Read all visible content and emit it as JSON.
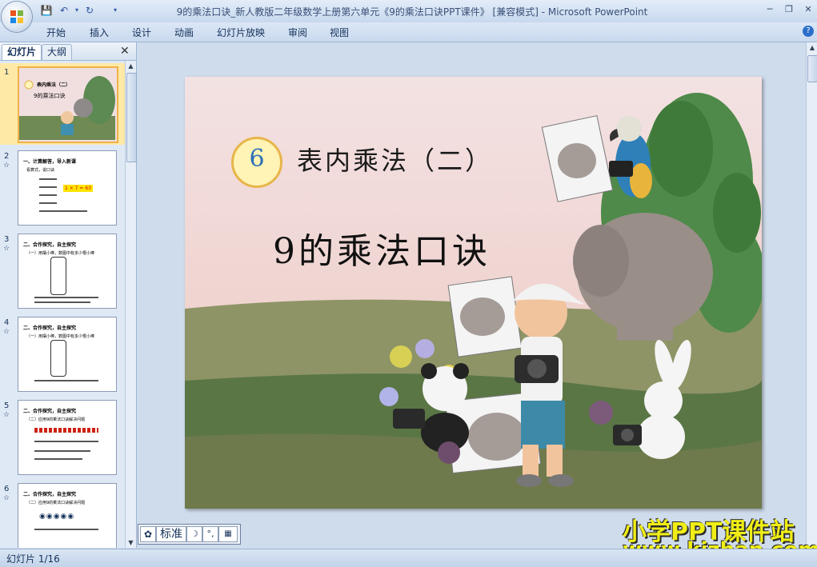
{
  "window": {
    "title": "9的乘法口诀_新人教版二年级数学上册第六单元《9的乘法口诀PPT课件》 [兼容模式] - Microsoft PowerPoint"
  },
  "ribbon": {
    "tabs": [
      "开始",
      "插入",
      "设计",
      "动画",
      "幻灯片放映",
      "审阅",
      "视图"
    ]
  },
  "left_pane": {
    "tabs": [
      "幻灯片",
      "大纲"
    ],
    "thumbnails": [
      {
        "num": "1",
        "title": "表内乘法（二）",
        "subtitle": "9的乘法口诀"
      },
      {
        "num": "2",
        "title": "一、计算解答，导入新课",
        "subtitle": "看算式，说口诀",
        "highlight": "1 × 7 = 63"
      },
      {
        "num": "3",
        "title": "二、合作探究，自主探究",
        "subtitle": "（一）用摆小棒，数图中有多少根小棒"
      },
      {
        "num": "4",
        "title": "二、合作探究，自主探究",
        "subtitle": "（一）用摆小棒，数图中有多少根小棒"
      },
      {
        "num": "5",
        "title": "二、合作探究，自主探究",
        "subtitle": "（二）应用9的乘法口诀解决问题"
      },
      {
        "num": "6",
        "title": "二、合作探究，自主探究",
        "subtitle": "（二）应用9的乘法口诀解决问题"
      }
    ]
  },
  "slide": {
    "unit_number": "6",
    "heading": "表内乘法（二）",
    "subtitle": "9的乘法口诀"
  },
  "view_toolbar": {
    "label": "标准"
  },
  "watermark": {
    "line1": "小学PPT课件站",
    "line2": "www.kjzhan.com"
  },
  "status": {
    "slide_counter": "幻灯片 1/16"
  }
}
